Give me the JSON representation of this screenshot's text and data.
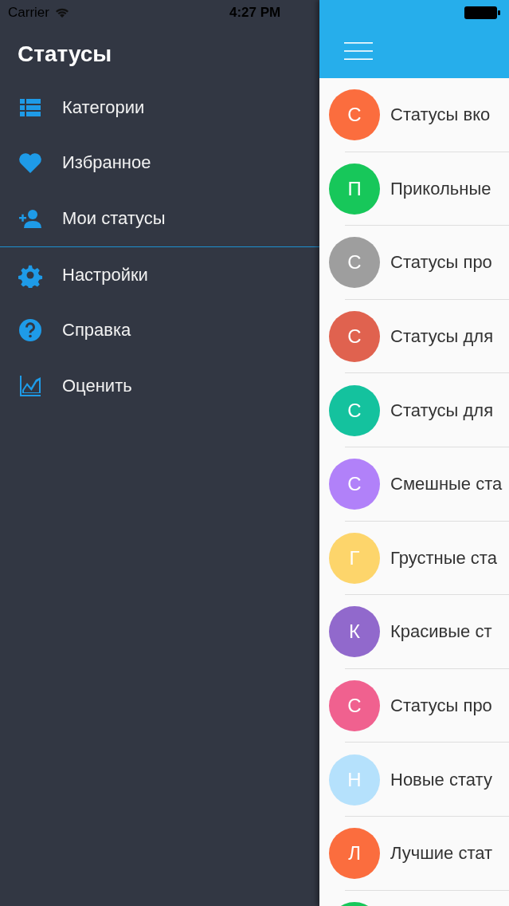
{
  "status_bar": {
    "carrier": "Carrier",
    "time": "4:27 PM"
  },
  "drawer": {
    "title": "Статусы",
    "sections": [
      [
        {
          "label": "Категории"
        },
        {
          "label": "Избранное"
        },
        {
          "label": "Мои статусы"
        }
      ],
      [
        {
          "label": "Настройки"
        },
        {
          "label": "Справка"
        },
        {
          "label": "Оценить"
        }
      ]
    ]
  },
  "list": [
    {
      "letter": "С",
      "title": "Статусы вко",
      "color": "#fb6d3e"
    },
    {
      "letter": "П",
      "title": "Прикольные",
      "color": "#17c75a"
    },
    {
      "letter": "С",
      "title": "Статусы про",
      "color": "#9e9e9e"
    },
    {
      "letter": "С",
      "title": "Статусы для",
      "color": "#e0624f"
    },
    {
      "letter": "С",
      "title": "Статусы для",
      "color": "#14c29e"
    },
    {
      "letter": "С",
      "title": "Смешные ста",
      "color": "#b181f9"
    },
    {
      "letter": "Г",
      "title": "Грустные ста",
      "color": "#fdd56b"
    },
    {
      "letter": "К",
      "title": "Красивые ст",
      "color": "#9169cc"
    },
    {
      "letter": "С",
      "title": "Статусы про",
      "color": "#f0618f"
    },
    {
      "letter": "Н",
      "title": "Новые стату",
      "color": "#b5e1fc"
    },
    {
      "letter": "Л",
      "title": "Лучшие стат",
      "color": "#fb6d3e"
    },
    {
      "color": "#17c75a"
    }
  ]
}
